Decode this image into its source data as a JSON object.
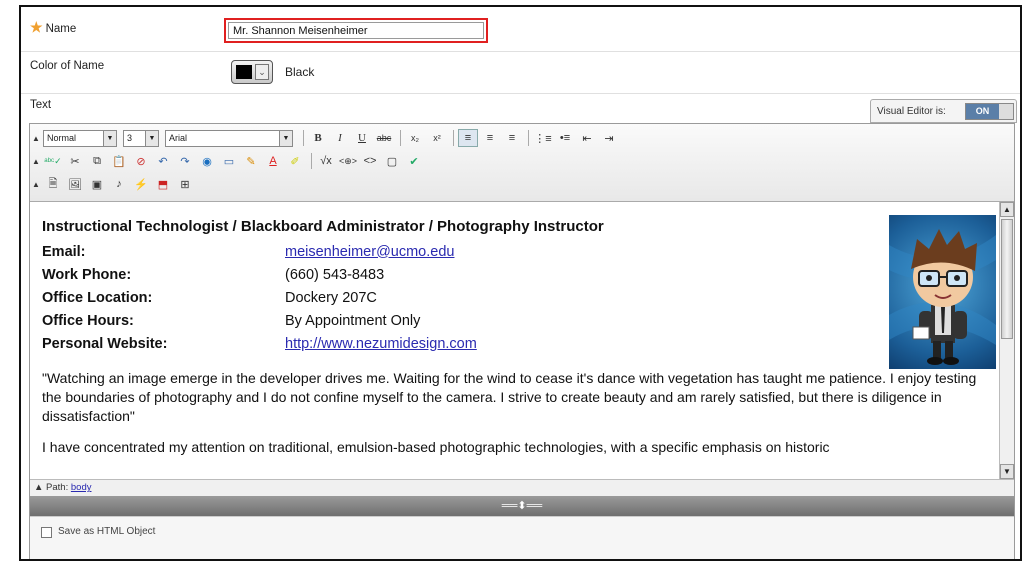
{
  "form": {
    "name_label": "Name",
    "name_value": "Mr. Shannon Meisenheimer",
    "color_label": "Color of Name",
    "color_value": "Black",
    "color_hex": "#000000",
    "text_label": "Text"
  },
  "visual_editor": {
    "label": "Visual Editor is:",
    "state": "ON"
  },
  "toolbar": {
    "format_select": "Normal",
    "size_select": "3",
    "font_select": "Arial",
    "row1": [
      "bold-icon",
      "italic-icon",
      "underline-icon",
      "strikethrough-icon",
      "subscript-icon",
      "superscript-icon",
      "align-left-icon",
      "align-center-icon",
      "align-right-icon",
      "ordered-list-icon",
      "unordered-list-icon",
      "outdent-icon",
      "indent-icon"
    ],
    "row2": [
      "spellcheck-icon",
      "cut-icon",
      "copy-icon",
      "paste-icon",
      "unlink-icon",
      "undo-icon",
      "redo-icon",
      "link-icon",
      "table-icon",
      "pencil-icon",
      "text-color-icon",
      "highlight-icon",
      "math-icon",
      "embed-icon",
      "html-icon",
      "preview-icon",
      "check-icon"
    ],
    "row3": [
      "attach-file-icon",
      "insert-image-icon",
      "insert-media-icon",
      "insert-audio-icon",
      "insert-flash-icon",
      "insert-pdf-icon",
      "insert-mashup-icon"
    ]
  },
  "content": {
    "title": "Instructional Technologist / Blackboard Administrator / Photography Instructor",
    "rows": [
      {
        "key": "Email:",
        "value": "meisenheimer@ucmo.edu"
      },
      {
        "key": "Work Phone:",
        "value": "(660) 543-8483"
      },
      {
        "key": "Office Location:",
        "value": "Dockery 207C"
      },
      {
        "key": "Office Hours:",
        "value": "By Appointment Only"
      },
      {
        "key": "Personal Website:",
        "value": "http://www.nezumidesign.com"
      }
    ],
    "quote": "\"Watching an image emerge in the developer drives me. Waiting for the wind to cease it's dance with vegetation has taught me patience. I enjoy testing the boundaries of photography and I do not confine myself to the camera. I strive to create beauty and am rarely satisfied, but there is diligence in dissatisfaction\"",
    "para2": "I have concentrated my attention on traditional, emulsion-based photographic technologies, with a specific emphasis on historic"
  },
  "pathbar": {
    "label": "Path:",
    "path": "body"
  },
  "html_object": {
    "label": "Save as HTML Object",
    "checked": false
  }
}
